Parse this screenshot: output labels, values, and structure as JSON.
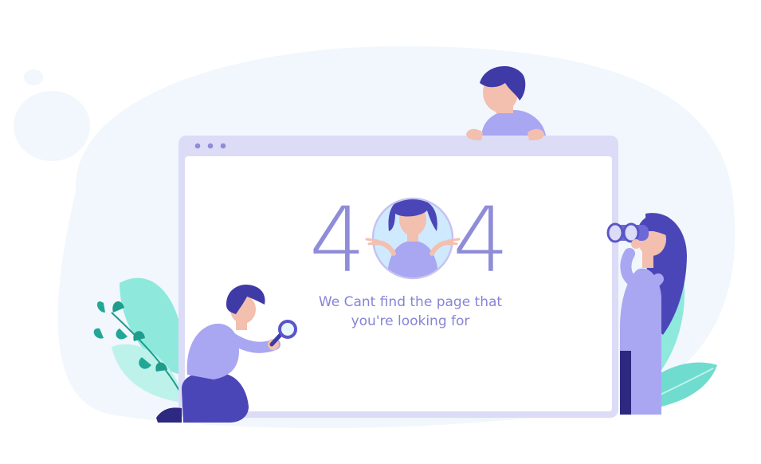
{
  "error": {
    "digit_left": "4",
    "digit_right": "4",
    "message_line1": "We Cant find the page  that",
    "message_line2": "you're looking for"
  },
  "colors": {
    "primary": "#8f8cd8",
    "indigo": "#4b46b7",
    "lavender": "#dcdcf7",
    "teal": "#60d2c8",
    "background_blob": "#f0f6fb"
  },
  "icons": [
    "window-dot-icon",
    "magnifier-icon",
    "binoculars-icon",
    "plant-leaf-icon"
  ]
}
